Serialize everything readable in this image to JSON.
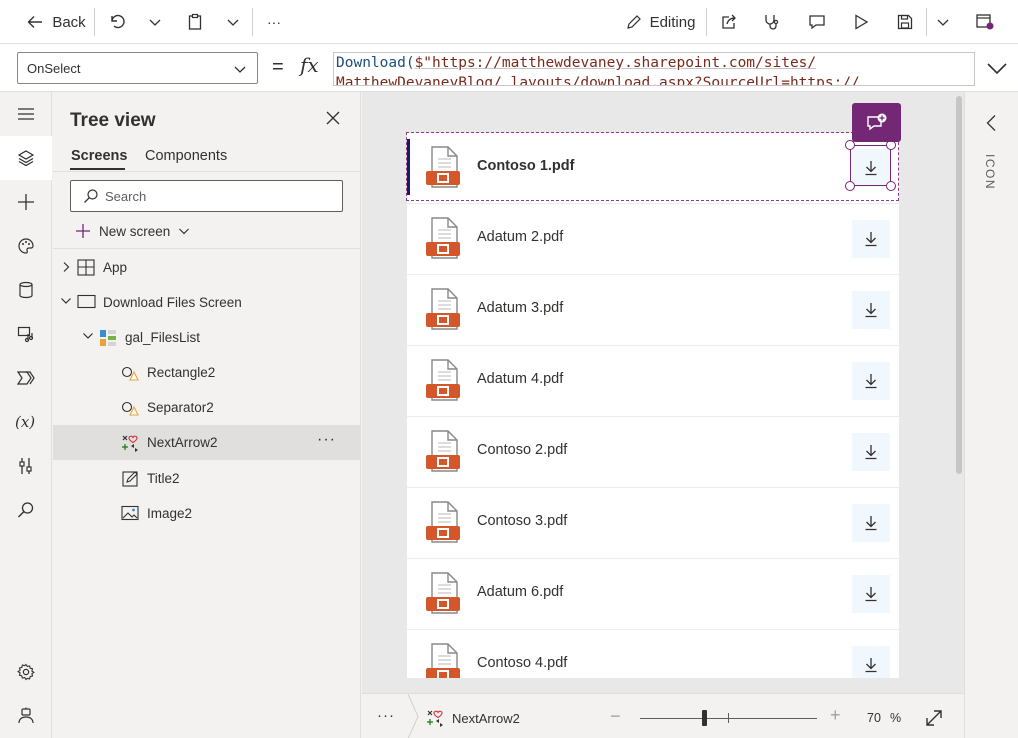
{
  "cmdbar": {
    "back_label": "Back",
    "editing_label": "Editing",
    "more_label": "···"
  },
  "formula_bar": {
    "property": "OnSelect",
    "equals": "=",
    "fx": "fx",
    "formula_fn": "Download(",
    "formula_str_1": "$\"https://matthewdevaney.sharepoint.com/sites/",
    "formula_line2": "MatthewDevaneyBlog/_layouts/download.aspx?SourceUrl=https://"
  },
  "tree_view": {
    "title": "Tree view",
    "tabs": [
      {
        "label": "Screens",
        "selected": true
      },
      {
        "label": "Components",
        "selected": false
      }
    ],
    "search_placeholder": "Search",
    "new_screen_label": "New screen",
    "nodes": [
      {
        "label": "App",
        "icon": "app-icon"
      },
      {
        "label": "Download Files Screen",
        "icon": "screen-icon"
      },
      {
        "label": "gal_FilesList",
        "icon": "gallery-icon"
      },
      {
        "label": "Rectangle2",
        "icon": "shape-icon"
      },
      {
        "label": "Separator2",
        "icon": "shape-icon"
      },
      {
        "label": "NextArrow2",
        "icon": "icon-control-icon",
        "selected": true
      },
      {
        "label": "Title2",
        "icon": "label-icon"
      },
      {
        "label": "Image2",
        "icon": "image-icon"
      }
    ],
    "node_more": "···"
  },
  "gallery": {
    "items": [
      "Contoso 1.pdf",
      "Adatum 2.pdf",
      "Adatum 3.pdf",
      "Adatum 4.pdf",
      "Contoso 2.pdf",
      "Contoso 3.pdf",
      "Adatum 6.pdf",
      "Contoso 4.pdf"
    ]
  },
  "right_panel": {
    "label": "ICON"
  },
  "status_bar": {
    "more": "···",
    "selected_control": "NextArrow2",
    "zoom_minus": "−",
    "zoom_plus": "+",
    "zoom_value": "70",
    "zoom_unit": "%"
  },
  "colors": {
    "accent": "#742774",
    "selection_bar": "#1b1a5f",
    "pdf_red": "#d4572c",
    "download_bg": "#f0f7fd"
  }
}
